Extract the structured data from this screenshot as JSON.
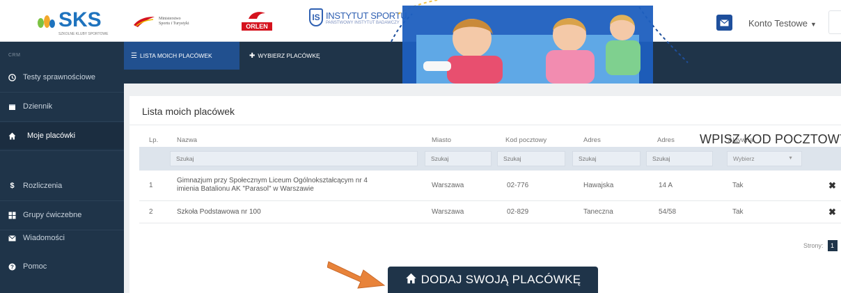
{
  "header": {
    "logo": {
      "name": "SKS",
      "tagline": "SZKOLNE KLUBY SPORTOWE"
    },
    "ministry_logo": {
      "lines": [
        "Ministerstwo",
        "Sportu i Turystyki"
      ]
    },
    "orlen_logo": {
      "text": "ORLEN"
    },
    "instytut_logo": {
      "line1": "INSTYTUT SPORTU",
      "line2": "PAŃSTWOWY INSTYTUT BADAWCZY"
    },
    "user_menu": "Konto Testowe",
    "icons": {
      "mail": "envelope-icon",
      "dropdown": "caret-down-icon"
    },
    "accent_color": "#1e4f9c"
  },
  "sidebar": {
    "section_label": "CRM",
    "items": [
      {
        "label": "Testy sprawnościowe",
        "icon": "clock-icon"
      },
      {
        "label": "Dziennik",
        "icon": "calendar-icon"
      },
      {
        "label": "Moje placówki",
        "icon": "home-icon",
        "active": true
      },
      {
        "label": "Rozliczenia",
        "icon": "dollar-icon"
      },
      {
        "label": "Grupy ćwiczebne",
        "icon": "grid-icon"
      },
      {
        "label": "Wiadomości",
        "icon": "envelope-icon"
      },
      {
        "label": "Pomoc",
        "icon": "question-icon"
      }
    ]
  },
  "topnav": {
    "tabs": [
      {
        "label": "LISTA MOICH PLACÓWEK",
        "icon": "list-icon",
        "active": true
      },
      {
        "label": "WYBIERZ PLACÓWKĘ",
        "icon": "plus-icon",
        "active": false
      }
    ]
  },
  "main": {
    "title": "Lista moich placówek",
    "columns": [
      "Lp.",
      "Nazwa",
      "Miasto",
      "Kod pocztowy",
      "Adres",
      "Adres",
      "Aktywna"
    ],
    "filters": {
      "nazwa": "Szukaj",
      "miasto": "Szukaj",
      "kod": "Szukaj",
      "adres1": "Szukaj",
      "adres2": "Szukaj",
      "aktywna": "Wybierz"
    },
    "rows": [
      {
        "lp": "1",
        "name_line1": "Gimnazjum przy Społecznym Liceum Ogólnokształcącym nr 4",
        "name_line2": "imienia Batalionu AK \"Parasol\" w Warszawie",
        "miasto": "Warszawa",
        "kod": "02-776",
        "adres1": "Hawajska",
        "adres2": "14 A",
        "aktywna": "Tak"
      },
      {
        "lp": "2",
        "name_line1": "Szkoła Podstawowa nr 100",
        "name_line2": "",
        "miasto": "Warszawa",
        "kod": "02-829",
        "adres1": "Taneczna",
        "adres2": "54/58",
        "aktywna": "Tak"
      }
    ],
    "pager_label": "Strony:",
    "current_page": "1"
  },
  "overlay_heading": "WPISZ KOD POCZTOWY",
  "add_button": {
    "label": "DODAJ SWOJĄ PLACÓWKĘ",
    "icon": "home-icon"
  },
  "colors": {
    "sidebar": "#1f3449",
    "active_tab": "#21508f",
    "arrow": "#e8833a"
  }
}
